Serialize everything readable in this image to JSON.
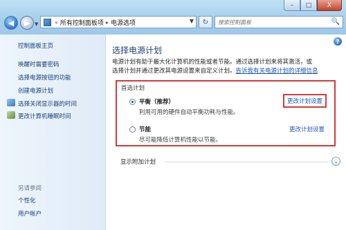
{
  "window": {
    "buttons": {
      "minimize": "–",
      "maximize": "□",
      "close": "X"
    }
  },
  "nav": {
    "back_icon": "back-arrow-icon",
    "forward_icon": "forward-arrow-icon",
    "back_glyph": "◀",
    "forward_glyph": "▶",
    "dropdown_glyph": "▼",
    "address": {
      "crumbs": [
        "所有控制面板项",
        "电源选项"
      ],
      "separator": "▸",
      "leading_sep": "«"
    },
    "refresh_glyph": "↻",
    "search_placeholder": "搜索控制面板",
    "search_glyph": "🔍"
  },
  "sidebar": {
    "home": "控制面板主页",
    "links": [
      "唤醒时需要密码",
      "选择电源按钮的功能",
      "创建电源计划",
      "选择关闭显示器的时间",
      "更改计算机睡眠时间"
    ],
    "see_also_label": "另请参阅",
    "see_also": [
      "个性化",
      "用户帐户"
    ]
  },
  "main": {
    "help_glyph": "?",
    "title": "选择电源计划",
    "desc_line1": "电源计划有助于最大化计算机的性能或者节能。通过选择计划来将其激活，或",
    "desc_line2_prefix": "选择计划并通过更改其电源设置来自定义计划。",
    "desc_link": "告诉我有关电源计划的详细信息",
    "preferred_label": "首选计划",
    "plans": [
      {
        "name": "平衡（推荐）",
        "desc": "利用可用的硬件自动平衡功耗与性能。",
        "change": "更改计划设置",
        "selected": true
      },
      {
        "name": "节能",
        "desc": "尽可能降低计算机性能以节能。",
        "change": "更改计划设置",
        "selected": false
      }
    ],
    "additional_label": "显示附加计划",
    "expand_glyph": "⌄"
  },
  "colors": {
    "highlight_border": "#d23a3a",
    "link": "#1a56b8",
    "title": "#1c3f76"
  }
}
